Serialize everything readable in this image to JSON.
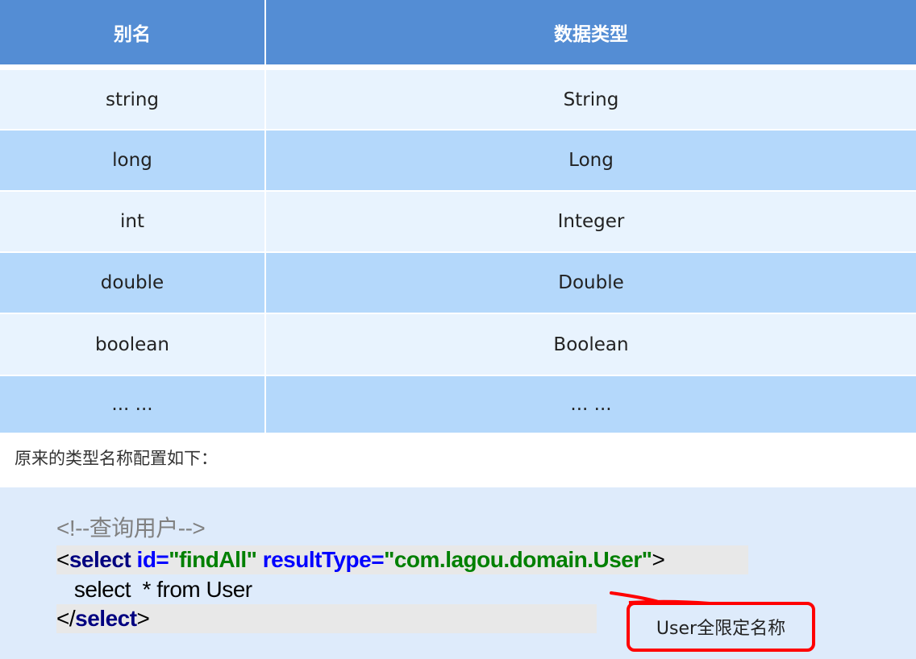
{
  "table": {
    "headers": [
      "别名",
      "数据类型"
    ],
    "rows": [
      [
        "string",
        "String"
      ],
      [
        "long",
        "Long"
      ],
      [
        "int",
        "Integer"
      ],
      [
        "double",
        "Double"
      ],
      [
        "boolean",
        "Boolean"
      ],
      [
        "... ...",
        "... ..."
      ]
    ]
  },
  "note": "原来的类型名称配置如下：",
  "code": {
    "comment": "<!--查询用户-->",
    "open_lt": "<",
    "tag": "select",
    "attr1": " id=",
    "val1": "\"findAll\"",
    "attr2": " resultType=",
    "val2": "\"com.lagou.domain.User\"",
    "open_gt": ">",
    "body": "   select  * from User",
    "close_lt": "</",
    "close_gt": ">"
  },
  "callout": {
    "text": "User全限定名称",
    "color": "#ff0000"
  }
}
